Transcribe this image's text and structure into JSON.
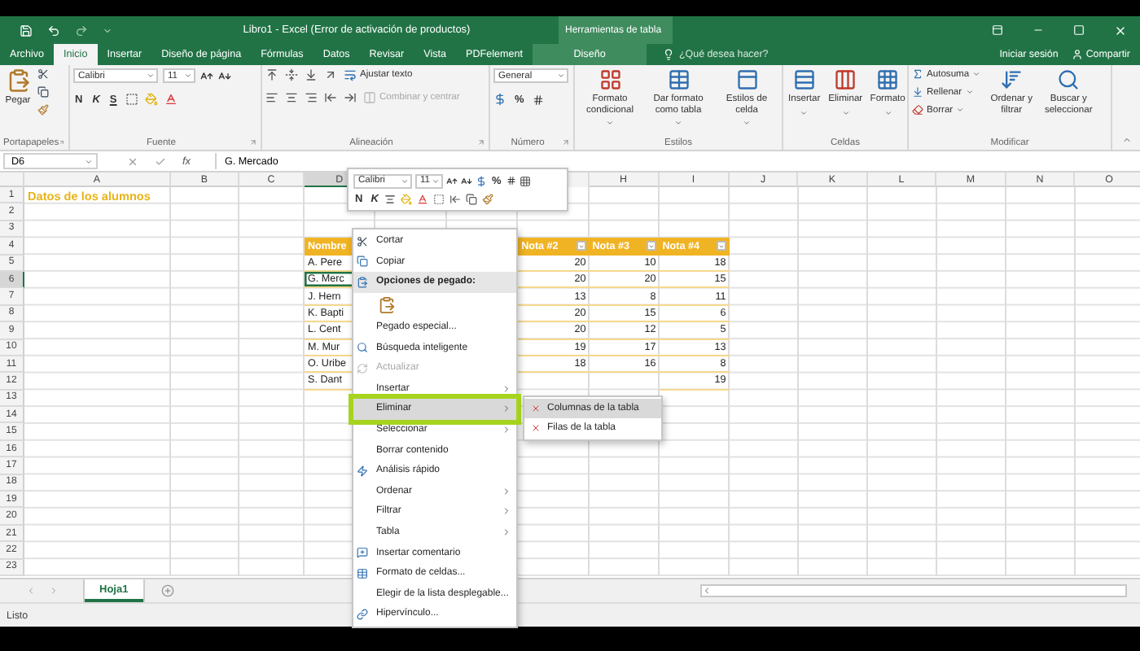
{
  "title_bar": {
    "title": "Libro1 - Excel (Error de activación de productos)",
    "context_title": "Herramientas de tabla"
  },
  "tabs": [
    {
      "label": "Archivo",
      "kind": "file",
      "selected": false
    },
    {
      "label": "Inicio",
      "kind": "tab",
      "selected": true
    },
    {
      "label": "Insertar",
      "kind": "tab",
      "selected": false
    },
    {
      "label": "Diseño de página",
      "kind": "tab",
      "selected": false
    },
    {
      "label": "Fórmulas",
      "kind": "tab",
      "selected": false
    },
    {
      "label": "Datos",
      "kind": "tab",
      "selected": false
    },
    {
      "label": "Revisar",
      "kind": "tab",
      "selected": false
    },
    {
      "label": "Vista",
      "kind": "tab",
      "selected": false
    },
    {
      "label": "PDFelement",
      "kind": "tab",
      "selected": false
    },
    {
      "label": "Diseño",
      "kind": "context",
      "selected": false
    }
  ],
  "tell_me": {
    "placeholder": "¿Qué desea hacer?"
  },
  "account": {
    "sign_in": "Iniciar sesión",
    "share": "Compartir"
  },
  "ribbon": {
    "clipboard": {
      "label": "Portapapeles",
      "paste": "Pegar",
      "launcher": true
    },
    "font": {
      "label": "Fuente",
      "font_name": "Calibri",
      "font_size": "11",
      "bold": "N",
      "italic": "K",
      "underline": "S",
      "launcher": true
    },
    "alignment": {
      "label": "Alineación",
      "wrap": "Ajustar texto",
      "merge": {
        "label": "Combinar y centrar",
        "disabled": true
      },
      "launcher": true
    },
    "number": {
      "label": "Número",
      "format": "General",
      "percent": "%",
      "launcher": true
    },
    "styles": {
      "label": "Estilos",
      "buttons": [
        "Formato condicional",
        "Dar formato como tabla",
        "Estilos de celda"
      ]
    },
    "cells": {
      "label": "Celdas",
      "buttons": [
        "Insertar",
        "Eliminar",
        "Formato"
      ]
    },
    "editing": {
      "label": "Modificar",
      "small": [
        "Autosuma",
        "Rellenar",
        "Borrar"
      ],
      "buttons": [
        "Ordenar y filtrar",
        "Buscar y seleccionar"
      ]
    }
  },
  "formula_bar": {
    "name_box": "D6",
    "function_label": "fx",
    "value": "G. Mercado"
  },
  "column_headers": [
    "A",
    "B",
    "C",
    "D",
    "H",
    "I",
    "J",
    "K",
    "L",
    "M",
    "N",
    "O"
  ],
  "row_headers": [
    "1",
    "2",
    "3",
    "4",
    "5",
    "6",
    "7",
    "8",
    "9",
    "10",
    "11",
    "12",
    "13",
    "14",
    "15",
    "16",
    "17",
    "18",
    "19",
    "20",
    "21",
    "22",
    "23"
  ],
  "sheet_title": "Datos de los alumnos",
  "table": {
    "name_header": "Nombre",
    "score_headers": [
      "Nota #2",
      "Nota #3",
      "Nota #4"
    ],
    "rows": [
      {
        "name": "A. Pere",
        "nota_2": "20",
        "nota_3": "10",
        "nota_4": "18",
        "selected": false
      },
      {
        "name": "G. Merc",
        "nota_2": "20",
        "nota_3": "20",
        "nota_4": "15",
        "selected": true
      },
      {
        "name": "J. Hern",
        "nota_2": "13",
        "nota_3": "8",
        "nota_4": "11",
        "selected": false
      },
      {
        "name": "K. Bapti",
        "nota_2": "20",
        "nota_3": "15",
        "nota_4": "6",
        "selected": false
      },
      {
        "name": "L. Cent",
        "nota_2": "20",
        "nota_3": "12",
        "nota_4": "5",
        "selected": false
      },
      {
        "name": "M. Mur",
        "nota_2": "19",
        "nota_3": "17",
        "nota_4": "13",
        "selected": false
      },
      {
        "name": "O. Uribe",
        "nota_2": "18",
        "nota_3": "16",
        "nota_4": "8",
        "selected": false
      },
      {
        "name": "S. Dant",
        "nota_4": "19",
        "selected": false
      }
    ]
  },
  "mini_toolbar": {
    "font_name": "Calibri",
    "font_size": "11",
    "percent": "%",
    "bold": "N",
    "italic": "K"
  },
  "context_menu": {
    "items": [
      {
        "label": "Cortar",
        "kind": "command",
        "disabled": false,
        "selected": false
      },
      {
        "label": "Copiar",
        "kind": "command",
        "disabled": false,
        "selected": false
      },
      {
        "label": "Opciones de pegado:",
        "kind": "header",
        "disabled": false,
        "selected": false
      },
      {
        "kind": "paste_options",
        "disabled": false,
        "selected": false
      },
      {
        "label": "Pegado especial...",
        "kind": "command",
        "disabled": false,
        "selected": false
      },
      {
        "label": "Búsqueda inteligente",
        "kind": "command",
        "disabled": false,
        "selected": false
      },
      {
        "label": "Actualizar",
        "kind": "command",
        "disabled": true,
        "selected": false
      },
      {
        "label": "Insertar",
        "kind": "submenu",
        "disabled": false,
        "selected": false
      },
      {
        "label": "Eliminar",
        "kind": "submenu",
        "disabled": false,
        "selected": true,
        "submenu": [
          {
            "label": "Columnas de la tabla",
            "selected": true
          },
          {
            "label": "Filas de la tabla",
            "selected": false
          }
        ]
      },
      {
        "label": "Seleccionar",
        "kind": "submenu",
        "disabled": false,
        "selected": false
      },
      {
        "label": "Borrar contenido",
        "kind": "command",
        "disabled": false,
        "selected": false
      },
      {
        "label": "Análisis rápido",
        "kind": "command",
        "disabled": false,
        "selected": false
      },
      {
        "label": "Ordenar",
        "kind": "submenu",
        "disabled": false,
        "selected": false
      },
      {
        "label": "Filtrar",
        "kind": "submenu",
        "disabled": false,
        "selected": false
      },
      {
        "label": "Tabla",
        "kind": "submenu",
        "disabled": false,
        "selected": false
      },
      {
        "label": "Insertar comentario",
        "kind": "command",
        "disabled": false,
        "selected": false
      },
      {
        "label": "Formato de celdas...",
        "kind": "command",
        "disabled": false,
        "selected": false
      },
      {
        "label": "Elegir de la lista desplegable...",
        "kind": "command",
        "disabled": false,
        "selected": false
      },
      {
        "label": "Hipervínculo...",
        "kind": "command",
        "disabled": false,
        "selected": false
      }
    ]
  },
  "sheet_tabs": [
    {
      "label": "Hoja1",
      "selected": true
    }
  ],
  "status_bar": {
    "text": "Listo"
  }
}
